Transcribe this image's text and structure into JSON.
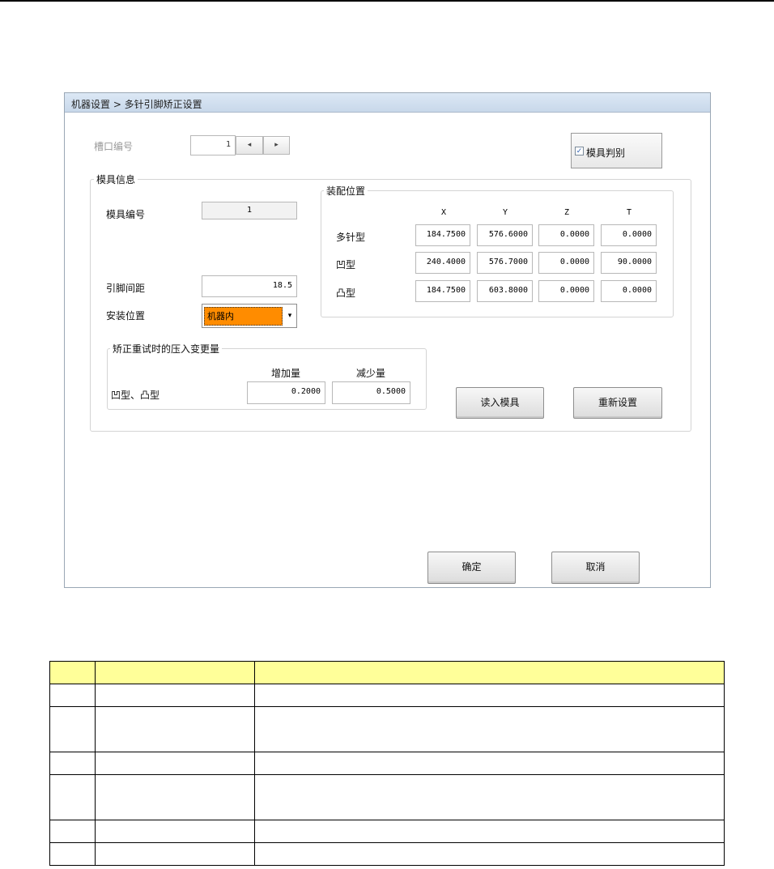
{
  "window": {
    "breadcrumb": "机器设置 > 多针引脚矫正设置"
  },
  "slot": {
    "label": "槽口编号",
    "value": "1",
    "prev_glyph": "◂",
    "next_glyph": "▸"
  },
  "mold_check": {
    "label": "模具判别",
    "checked": true,
    "check_glyph": "✓"
  },
  "mold_info": {
    "title": "模具信息",
    "mold_no_label": "模具编号",
    "mold_no_value": "1",
    "pin_pitch_label": "引脚间距",
    "pin_pitch_value": "18.5",
    "install_pos_label": "安装位置",
    "install_pos_value": "机器内",
    "dropdown_glyph": "▾"
  },
  "mount_pos": {
    "title": "装配位置",
    "columns": [
      "X",
      "Y",
      "Z",
      "T"
    ],
    "rows": [
      {
        "label": "多针型",
        "values": [
          "184.7500",
          "576.6000",
          "0.0000",
          "0.0000"
        ]
      },
      {
        "label": "凹型",
        "values": [
          "240.4000",
          "576.7000",
          "0.0000",
          "90.0000"
        ]
      },
      {
        "label": "凸型",
        "values": [
          "184.7500",
          "603.8000",
          "0.0000",
          "0.0000"
        ]
      }
    ]
  },
  "correction": {
    "title": "矫正重试时的压入变更量",
    "increase_label": "增加量",
    "decrease_label": "减少量",
    "row_label": "凹型、凸型",
    "increase_value": "0.2000",
    "decrease_value": "0.5000"
  },
  "buttons": {
    "read_mold": "读入模具",
    "reset": "重新设置",
    "ok": "确定",
    "cancel": "取消"
  },
  "colors": {
    "selected_combo": "#ff8c00",
    "table_header": "#ffff99",
    "titlebar": "#c8d8ea"
  }
}
